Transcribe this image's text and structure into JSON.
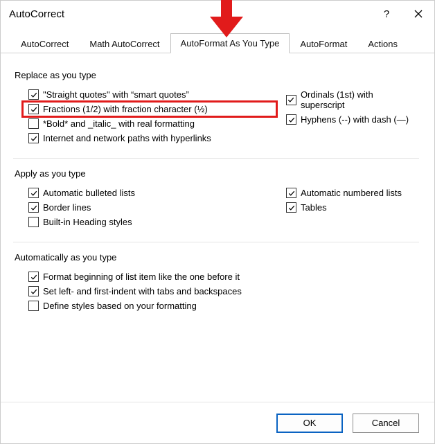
{
  "title": "AutoCorrect",
  "help_symbol": "?",
  "tabs": [
    {
      "label": "AutoCorrect"
    },
    {
      "label": "Math AutoCorrect"
    },
    {
      "label": "AutoFormat As You Type",
      "active": true
    },
    {
      "label": "AutoFormat"
    },
    {
      "label": "Actions"
    }
  ],
  "sections": {
    "replace": {
      "heading": "Replace as you type",
      "left": [
        {
          "key": "straight_quotes",
          "label": "\"Straight quotes\" with “smart quotes”",
          "checked": true
        },
        {
          "key": "fractions",
          "label": "Fractions (1/2) with fraction character (½)",
          "checked": true,
          "highlight": true
        },
        {
          "key": "bold_italic",
          "label": "*Bold* and _italic_ with real formatting",
          "checked": false
        },
        {
          "key": "net_paths",
          "label": "Internet and network paths with hyperlinks",
          "checked": true
        }
      ],
      "right": [
        {
          "key": "ordinals",
          "label": "Ordinals (1st) with superscript",
          "checked": true
        },
        {
          "key": "hyphens",
          "label": "Hyphens (--) with dash (—)",
          "checked": true
        }
      ]
    },
    "apply": {
      "heading": "Apply as you type",
      "left": [
        {
          "key": "auto_bullets",
          "label": "Automatic bulleted lists",
          "checked": true
        },
        {
          "key": "border_lines",
          "label": "Border lines",
          "checked": true
        },
        {
          "key": "heading_styles",
          "label": "Built-in Heading styles",
          "checked": false
        }
      ],
      "right": [
        {
          "key": "auto_numbered",
          "label": "Automatic numbered lists",
          "checked": true
        },
        {
          "key": "tables",
          "label": "Tables",
          "checked": true
        }
      ]
    },
    "auto": {
      "heading": "Automatically as you type",
      "left": [
        {
          "key": "format_beginning",
          "label": "Format beginning of list item like the one before it",
          "checked": true
        },
        {
          "key": "set_indent",
          "label": "Set left- and first-indent with tabs and backspaces",
          "checked": true
        },
        {
          "key": "define_styles",
          "label": "Define styles based on your formatting",
          "checked": false
        }
      ],
      "right": []
    }
  },
  "buttons": {
    "ok": "OK",
    "cancel": "Cancel"
  },
  "annotation": {
    "arrow_color": "#e11b1b"
  }
}
